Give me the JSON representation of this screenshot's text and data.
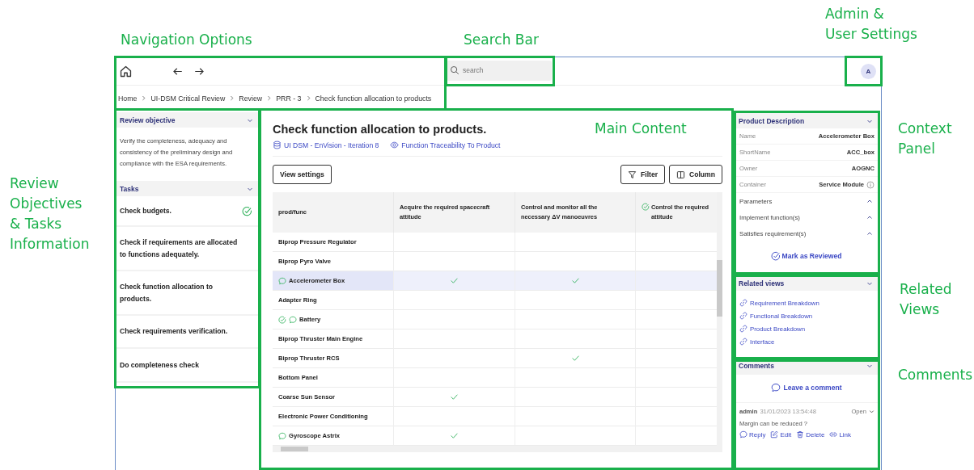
{
  "annotations": [
    {
      "text": "Navigation Options"
    },
    {
      "text": "Search Bar"
    },
    {
      "text": "Admin &\nUser Settings"
    },
    {
      "text": "Main Content"
    },
    {
      "text": "Context\nPanel"
    },
    {
      "text": "Review\nObjectives\n& Tasks\nInformation"
    },
    {
      "text": "Related\nViews"
    },
    {
      "text": "Comments"
    }
  ],
  "top_bar": {
    "search": {
      "placeholder": "search"
    },
    "avatar": "A"
  },
  "breadcrumb": [
    "Home",
    "UI-DSM Critical Review",
    "Review",
    "PRR - 3",
    "Check function allocation to products"
  ],
  "review_objective": {
    "title": "Review objective",
    "expanded": true,
    "text": "Verify the completeness, adequacy and consistency of the preliminary design and compliance with the ESA requirements."
  },
  "tasks": {
    "title": "Tasks",
    "expanded": true,
    "items": [
      {
        "label": "Check budgets.",
        "done": true
      },
      {
        "label": "Check if requirements are allocated to functions adequately.",
        "done": false
      },
      {
        "label": "Check function allocation to products.",
        "done": false
      },
      {
        "label": "Check requirements verification.",
        "done": false
      },
      {
        "label": "Do completeness check",
        "done": false
      }
    ]
  },
  "main": {
    "title": "Check function allocation to products.",
    "links": [
      {
        "kind": "model",
        "text": "UI DSM - EnVision - Iteration 8"
      },
      {
        "kind": "view",
        "text": "Function Traceability To Product"
      }
    ],
    "buttons": [
      {
        "kind": "settings",
        "label": "View settings"
      },
      {
        "kind": "filter",
        "label": "Filter"
      },
      {
        "kind": "column",
        "label": "Column"
      }
    ]
  },
  "table": {
    "columns": [
      {
        "label": "prod/func",
        "reviewed": false
      },
      {
        "label": "Acquire the required spacecraft\nattitude",
        "reviewed": false
      },
      {
        "label": "Control and monitor all the\nnecessary ΔV manoeuvres",
        "reviewed": false
      },
      {
        "label": "Control the required\nattitude",
        "reviewed": true
      }
    ],
    "rows": [
      {
        "name": "Biprop Pressure Regulator",
        "selected": false,
        "reviewed": false,
        "commented": false,
        "allocations": [
          false,
          false,
          false
        ]
      },
      {
        "name": "Biprop Pyro Valve",
        "selected": false,
        "reviewed": false,
        "commented": false,
        "allocations": [
          false,
          false,
          false
        ]
      },
      {
        "name": "Accelerometer Box",
        "selected": true,
        "reviewed": false,
        "commented": true,
        "allocations": [
          true,
          true,
          false
        ]
      },
      {
        "name": "Adapter Ring",
        "selected": false,
        "reviewed": false,
        "commented": false,
        "allocations": [
          false,
          false,
          false
        ]
      },
      {
        "name": "Battery",
        "selected": false,
        "reviewed": true,
        "commented": true,
        "allocations": [
          false,
          false,
          false
        ]
      },
      {
        "name": "Biprop Thruster Main Engine",
        "selected": false,
        "reviewed": false,
        "commented": false,
        "allocations": [
          false,
          false,
          false
        ]
      },
      {
        "name": "Biprop Thruster RCS",
        "selected": false,
        "reviewed": false,
        "commented": false,
        "allocations": [
          false,
          true,
          false
        ]
      },
      {
        "name": "Bottom Panel",
        "selected": false,
        "reviewed": false,
        "commented": false,
        "allocations": [
          false,
          false,
          false
        ]
      },
      {
        "name": "Coarse Sun Sensor",
        "selected": false,
        "reviewed": false,
        "commented": false,
        "allocations": [
          true,
          false,
          false
        ]
      },
      {
        "name": "Electronic Power Conditioning",
        "selected": false,
        "reviewed": false,
        "commented": false,
        "allocations": [
          false,
          false,
          false
        ]
      },
      {
        "name": "Gyroscope Astrix",
        "selected": false,
        "reviewed": false,
        "commented": true,
        "allocations": [
          true,
          false,
          false
        ]
      }
    ]
  },
  "product_description": {
    "title": "Product Description",
    "expanded": true,
    "properties": [
      {
        "label": "Name",
        "value": "Accelerometer Box",
        "info": false
      },
      {
        "label": "ShortName",
        "value": "ACC_box",
        "info": false
      },
      {
        "label": "Owner",
        "value": "AOGNC",
        "info": false
      },
      {
        "label": "Container",
        "value": "Service Module",
        "info": true
      }
    ],
    "sections": [
      {
        "label": "Parameters",
        "expanded": false
      },
      {
        "label": "Implement function(s)",
        "expanded": false
      },
      {
        "label": "Satisfies requirement(s)",
        "expanded": false
      }
    ],
    "action": "Mark as Reviewed"
  },
  "related_views": {
    "title": "Related views",
    "expanded": true,
    "links": [
      "Requirement Breakdown",
      "Functional Breakdown",
      "Product Breakdown",
      "Interface"
    ]
  },
  "comments": {
    "title": "Comments",
    "expanded": true,
    "leave": "Leave a comment",
    "items": [
      {
        "author": "admin",
        "time": "31/01/2023 13:54:48",
        "status": "Open",
        "text": "Margin can be reduced ?",
        "actions": [
          {
            "kind": "reply",
            "label": "Reply"
          },
          {
            "kind": "edit",
            "label": "Edit"
          },
          {
            "kind": "delete",
            "label": "Delete"
          },
          {
            "kind": "link",
            "label": "Link"
          }
        ]
      }
    ]
  }
}
